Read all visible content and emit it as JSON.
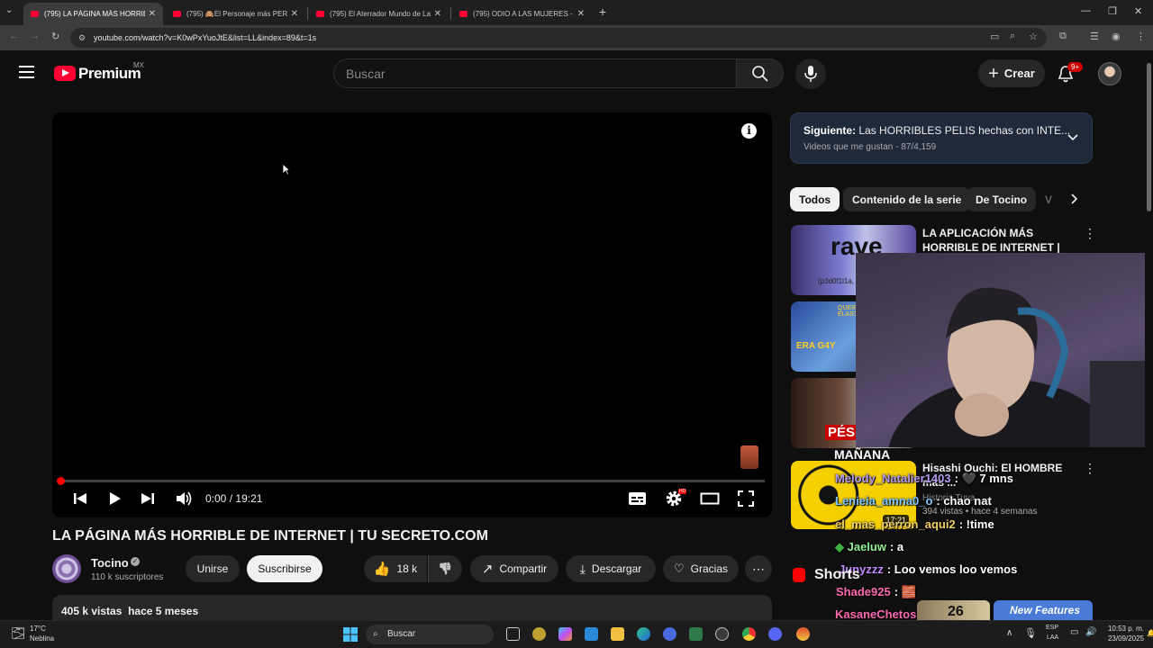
{
  "browser": {
    "tabs": [
      {
        "label": "(795) LA PÁGINA MÁS HORRIBLE",
        "active": true
      },
      {
        "label": "(795) 🙈El Personaje más PERT"
      },
      {
        "label": "(795) El Aterrador Mundo de La"
      },
      {
        "label": "(795) ODIO A LAS MUJERES - Y"
      }
    ],
    "url": "youtube.com/watch?v=K0wPxYuoJtE&list=LL&index=89&t=1s"
  },
  "header": {
    "logo_text": "Premium",
    "region": "MX",
    "search_placeholder": "Buscar",
    "create_label": "Crear",
    "notifications": "9+"
  },
  "player": {
    "current_time": "0:00",
    "separator": "/",
    "duration": "19:21",
    "progress": 0.0,
    "hd_badge": "HD"
  },
  "video": {
    "title": "LA PÁGINA MÁS HORRIBLE DE INTERNET | TU SECRETO.COM",
    "channel": "Tocino",
    "subscribers": "110 k suscriptores",
    "join_label": "Unirse",
    "subscribe_label": "Suscribirse",
    "likes": "18 k",
    "share_label": "Compartir",
    "download_label": "Descargar",
    "thanks_label": "Gracias",
    "views": "405 k vistas",
    "age": "hace 5 meses"
  },
  "playlist_next": {
    "prefix": "Siguiente:",
    "title": "Las HORRIBLES PELIS hechas con INTE...",
    "subtitle": "Videos que me gustan - 87/4,159"
  },
  "chips": [
    "Todos",
    "Contenido de la serie",
    "De Tocino",
    "V"
  ],
  "recommendations": [
    {
      "title": "LA APLICACIÓN MÁS HORRIBLE DE INTERNET | RAV...",
      "thumb_text": "rave",
      "thumb_sub": "(p3d0f1l1a, p"
    },
    {
      "title": "",
      "thumb_text": "ERA G4Y",
      "thumb_sub": "QUERI ELAST"
    },
    {
      "title": "",
      "thumb_text": "PÉSI",
      "thumb_sub": ""
    },
    {
      "title": "Hisashi Ouchi: El HOMBRE más ...",
      "meta": "394 vistas • hace 4 semanas",
      "channel": "Historia Tuya",
      "thumb_text": "17:21"
    }
  ],
  "overlay_banner": "MAÑANA",
  "chat": [
    {
      "user": "Melody_Natalier1403",
      "msg": ": 🖤 7 mns"
    },
    {
      "user": "Lenieia_amna0_o",
      "msg": ": chao nat"
    },
    {
      "user": "el_mas_perron_aqui2",
      "msg": ": !time"
    },
    {
      "user": "Jaeluw",
      "msg": ": a"
    },
    {
      "user": "Junyzzz",
      "msg": ": Loo vemos loo vemos"
    },
    {
      "user": "Shade925",
      "msg": ": 🧱"
    },
    {
      "user": "KasaneChetos",
      "msg": ": "
    }
  ],
  "shorts_label": "Shorts",
  "shorts_thumb": {
    "title": "New Features",
    "overlay": "26"
  },
  "taskbar": {
    "temperature": "17°C",
    "condition": "Neblina",
    "search_label": "Buscar",
    "lang1": "ESP",
    "lang2": "LAA",
    "time": "10:53 p. m.",
    "date": "23/09/2025"
  },
  "colors": {
    "accent": "#ff0033",
    "background": "#0f0f0f",
    "chip_bg": "#272727",
    "next_panel_bg": "#1e2a3a"
  }
}
